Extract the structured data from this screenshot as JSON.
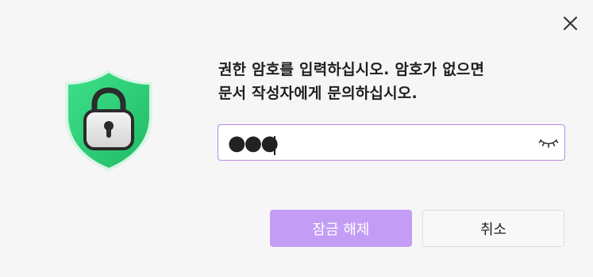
{
  "dialog": {
    "message_line1": "권한 암호를 입력하십시오. 암호가 없으면",
    "message_line2": "문서 작성자에게 문의하십시오.",
    "password": {
      "masked_value": "●●●",
      "visibility_icon": "eye-closed-icon"
    },
    "buttons": {
      "unlock": "잠금 해제",
      "cancel": "취소"
    },
    "icons": {
      "close": "close-icon",
      "shield": "shield-lock-icon"
    },
    "colors": {
      "accent": "#c39df5",
      "input_border": "#b78ce6",
      "shield_green": "#2ecc71"
    }
  }
}
